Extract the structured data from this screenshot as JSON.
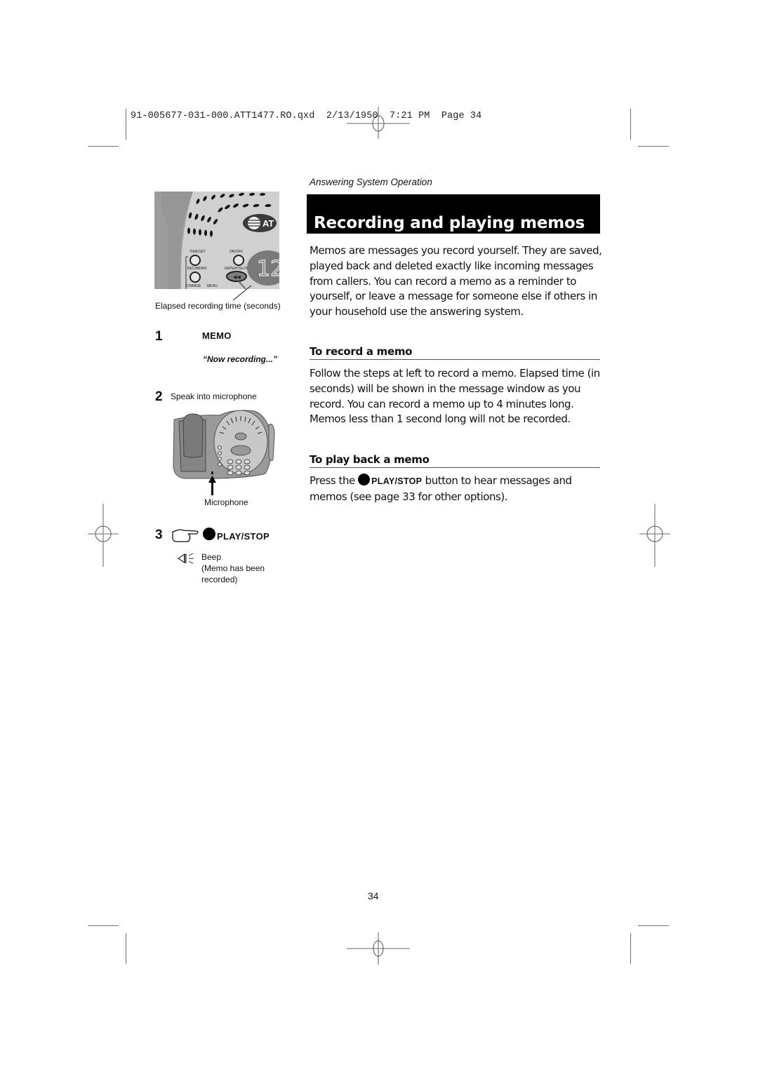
{
  "print_slug": "91-005677-031-000.ATT1477.RO.qxd  2/13/1950  7:21 PM  Page 34",
  "section_label": "Answering System Operation",
  "title": "Recording and playing memos",
  "intro": "Memos are messages you record yourself. They are saved, played back and deleted exactly like incoming messages from callers. You can record a memo as a reminder to yourself, or leave a message for someone else if others in your household use the answering system.",
  "record_section": {
    "heading": "To record a memo",
    "text": "Follow the steps at left to record a memo. Elapsed time (in seconds) will be shown in the message window as you record. You can record a memo up to 4 minutes long. Memos less than 1 second long will not be recorded."
  },
  "playback_section": {
    "heading": "To play back a memo",
    "text_before": "Press the ",
    "button_label": "PLAY/STOP",
    "text_after": " button to hear messages and memos (see page 33 for other options)."
  },
  "illustration_top": {
    "display_value": "12",
    "logo_text": "AT",
    "button_labels": [
      "TIME/SET",
      "ON/OFF",
      "REC/MEMO",
      "REPEAT/SLOW",
      "CHANGE",
      "MENU"
    ],
    "caption": "Elapsed recording time (seconds)"
  },
  "steps": [
    {
      "number": "1",
      "button_label": "MEMO",
      "prompt": "“Now recording...”"
    },
    {
      "number": "2",
      "instruction": "Speak into microphone",
      "illustration_caption": "Microphone"
    },
    {
      "number": "3",
      "icon": "pointing-hand-icon",
      "button_label": "PLAY/STOP",
      "result_icon": "speaker-icon",
      "result_text_1": "Beep",
      "result_text_2": "(Memo has been",
      "result_text_3": "recorded)"
    }
  ],
  "page_number": "34"
}
